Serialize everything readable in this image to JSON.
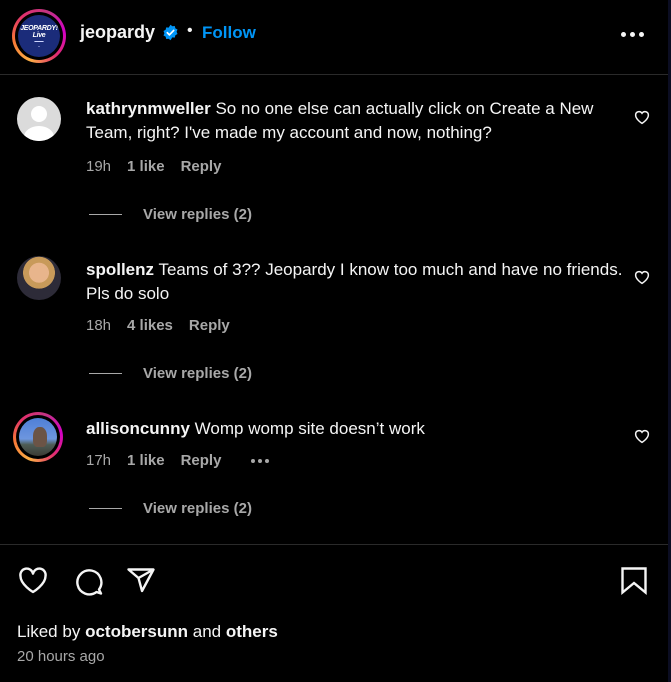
{
  "header": {
    "username": "jeopardy",
    "verified": true,
    "separator": "•",
    "follow_label": "Follow",
    "avatar_logo_text": "JEOPARDY!",
    "avatar_logo_subtext": "Live",
    "more_icon": "more-horizontal-icon",
    "accent_color": "#0095f6"
  },
  "comments": [
    {
      "username": "kathrynmweller",
      "text": "So no one else can actually click on Create a New Team, right? I've made my account and now, nothing?",
      "time": "19h",
      "likes": "1 like",
      "reply_label": "Reply",
      "view_replies": "View replies (2)",
      "avatar": "default-avatar"
    },
    {
      "username": "spollenz",
      "text": "Teams of 3?? Jeopardy I know too much and have no friends. Pls do solo",
      "time": "18h",
      "likes": "4 likes",
      "reply_label": "Reply",
      "view_replies": "View replies (2)",
      "avatar": "photo-avatar"
    },
    {
      "username": "allisoncunny",
      "text": "Womp womp site doesn’t work",
      "time": "17h",
      "likes": "1 like",
      "reply_label": "Reply",
      "view_replies": "View replies (2)",
      "avatar": "story-ring-avatar",
      "has_more_menu": true
    }
  ],
  "actions": {
    "like_icon": "heart-icon",
    "comment_icon": "comment-icon",
    "share_icon": "send-icon",
    "save_icon": "bookmark-icon"
  },
  "footer": {
    "liked_by_prefix": "Liked by",
    "liked_by_user": "octobersunn",
    "liked_by_and": "and",
    "liked_by_others": "others",
    "timestamp": "20 hours ago"
  }
}
